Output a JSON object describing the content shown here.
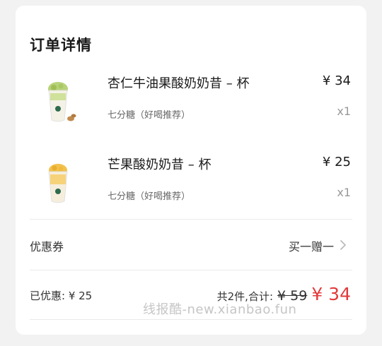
{
  "title": "订单详情",
  "items": [
    {
      "name": "杏仁牛油果酸奶奶昔 – 杯",
      "price": "¥ 34",
      "option": "七分糖（好喝推荐）",
      "qty": "x1",
      "thumb_icon": "avocado-yogurt-cup-image"
    },
    {
      "name": "芒果酸奶奶昔 – 杯",
      "price": "¥ 25",
      "option": "七分糖（好喝推荐）",
      "qty": "x1",
      "thumb_icon": "mango-yogurt-cup-image"
    }
  ],
  "coupon": {
    "label": "优惠券",
    "value": "买一赠一"
  },
  "summary": {
    "discount": "已优惠: ¥ 25",
    "count_total_label": "共2件,合计:",
    "original_price": "¥ 59",
    "final_price": "¥ 34"
  },
  "watermark": "线报酷-new.xianbao.fun",
  "colors": {
    "accent_red": "#e23a3a",
    "avocado_green": "#b8d27a",
    "mango_yellow": "#f2c14e"
  }
}
